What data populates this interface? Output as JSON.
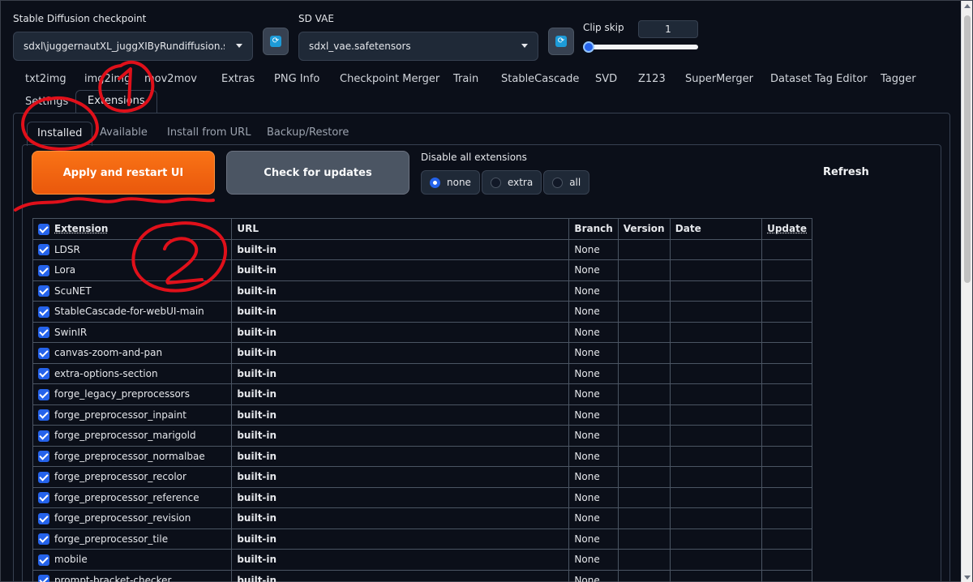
{
  "header": {
    "checkpoint": {
      "label": "Stable Diffusion checkpoint",
      "value": "sdxl\\juggernautXL_juggXIByRundiffusion.safetensors"
    },
    "vae": {
      "label": "SD VAE",
      "value": "sdxl_vae.safetensors"
    },
    "clip_skip": {
      "label": "Clip skip",
      "value": "1",
      "slider_fraction": 0.0
    },
    "refresh_icon": "refresh-icon"
  },
  "main_tabs": [
    "txt2img",
    "img2img",
    "mov2mov",
    "Extras",
    "PNG Info",
    "Checkpoint Merger",
    "Train",
    "StableCascade",
    "SVD",
    "Z123",
    "SuperMerger",
    "Dataset Tag Editor",
    "Tagger",
    "Settings",
    "Extensions"
  ],
  "selected_main_tab": "Extensions",
  "sub_tabs": [
    "Installed",
    "Available",
    "Install from URL",
    "Backup/Restore"
  ],
  "selected_sub_tab": "Installed",
  "actions": {
    "apply_label": "Apply and restart UI",
    "check_label": "Check for updates",
    "disable_label": "Disable all extensions",
    "disable_options": [
      "none",
      "extra",
      "all"
    ],
    "disable_selected": "none",
    "refresh_label": "Refresh"
  },
  "table": {
    "headers": [
      "Extension",
      "URL",
      "Branch",
      "Version",
      "Date",
      "Update"
    ],
    "rows": [
      {
        "name": "LDSR",
        "url": "built-in",
        "branch": "None"
      },
      {
        "name": "Lora",
        "url": "built-in",
        "branch": "None"
      },
      {
        "name": "ScuNET",
        "url": "built-in",
        "branch": "None"
      },
      {
        "name": "StableCascade-for-webUI-main",
        "url": "built-in",
        "branch": "None"
      },
      {
        "name": "SwinIR",
        "url": "built-in",
        "branch": "None"
      },
      {
        "name": "canvas-zoom-and-pan",
        "url": "built-in",
        "branch": "None"
      },
      {
        "name": "extra-options-section",
        "url": "built-in",
        "branch": "None"
      },
      {
        "name": "forge_legacy_preprocessors",
        "url": "built-in",
        "branch": "None"
      },
      {
        "name": "forge_preprocessor_inpaint",
        "url": "built-in",
        "branch": "None"
      },
      {
        "name": "forge_preprocessor_marigold",
        "url": "built-in",
        "branch": "None"
      },
      {
        "name": "forge_preprocessor_normalbae",
        "url": "built-in",
        "branch": "None"
      },
      {
        "name": "forge_preprocessor_recolor",
        "url": "built-in",
        "branch": "None"
      },
      {
        "name": "forge_preprocessor_reference",
        "url": "built-in",
        "branch": "None"
      },
      {
        "name": "forge_preprocessor_revision",
        "url": "built-in",
        "branch": "None"
      },
      {
        "name": "forge_preprocessor_tile",
        "url": "built-in",
        "branch": "None"
      },
      {
        "name": "mobile",
        "url": "built-in",
        "branch": "None"
      },
      {
        "name": "prompt-bracket-checker",
        "url": "built-in",
        "branch": "None"
      }
    ]
  },
  "colors": {
    "background": "#0b0f19",
    "accent_orange": "#ea580c",
    "accent_blue": "#2563eb",
    "annotation_red": "#e0101a"
  }
}
